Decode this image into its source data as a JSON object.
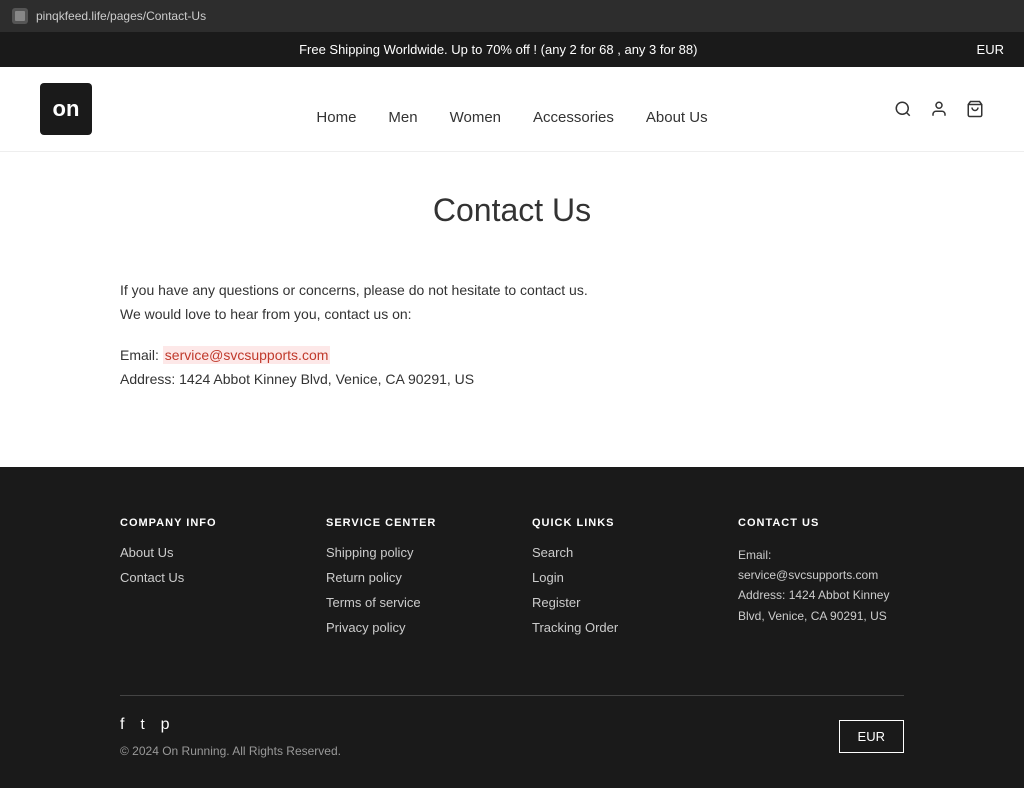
{
  "browser": {
    "url": "pinqkfeed.life/pages/Contact-Us"
  },
  "banner": {
    "message": "Free Shipping Worldwide. Up to 70% off !  (any 2 for 68 , any 3 for 88)",
    "currency": "EUR"
  },
  "header": {
    "logo_text": "on",
    "nav": [
      {
        "label": "Home",
        "href": "#"
      },
      {
        "label": "Men",
        "href": "#"
      },
      {
        "label": "Women",
        "href": "#"
      },
      {
        "label": "Accessories",
        "href": "#"
      },
      {
        "label": "About Us",
        "href": "#"
      }
    ]
  },
  "main": {
    "page_title": "Contact Us",
    "intro_line1": "If you have any questions or concerns, please do not hesitate to contact us.",
    "intro_line2": "We would love to hear from you, contact us on:",
    "email_label": "Email: ",
    "email_value": "service@svcsupports.com",
    "address_label": "Address: ",
    "address_value": "1424 Abbot Kinney Blvd, Venice, CA 90291, US"
  },
  "footer": {
    "columns": [
      {
        "title": "COMPANY INFO",
        "links": [
          {
            "label": "About Us",
            "href": "#"
          },
          {
            "label": "Contact Us",
            "href": "#"
          }
        ]
      },
      {
        "title": "SERVICE CENTER",
        "links": [
          {
            "label": "Shipping policy",
            "href": "#"
          },
          {
            "label": "Return policy",
            "href": "#"
          },
          {
            "label": "Terms of service",
            "href": "#"
          },
          {
            "label": "Privacy policy",
            "href": "#"
          }
        ]
      },
      {
        "title": "QUICK LINKS",
        "links": [
          {
            "label": "Search",
            "href": "#"
          },
          {
            "label": "Login",
            "href": "#"
          },
          {
            "label": "Register",
            "href": "#"
          },
          {
            "label": "Tracking Order",
            "href": "#"
          }
        ]
      },
      {
        "title": "CONTACT US",
        "email_label": "Email: service@svcsupports.com",
        "address_label": "Address: 1424 Abbot Kinney Blvd, Venice, CA 90291, US"
      }
    ],
    "copyright": "© 2024 On Running. All Rights Reserved.",
    "currency_btn": "EUR",
    "social_icons": [
      "f",
      "t",
      "p"
    ]
  }
}
